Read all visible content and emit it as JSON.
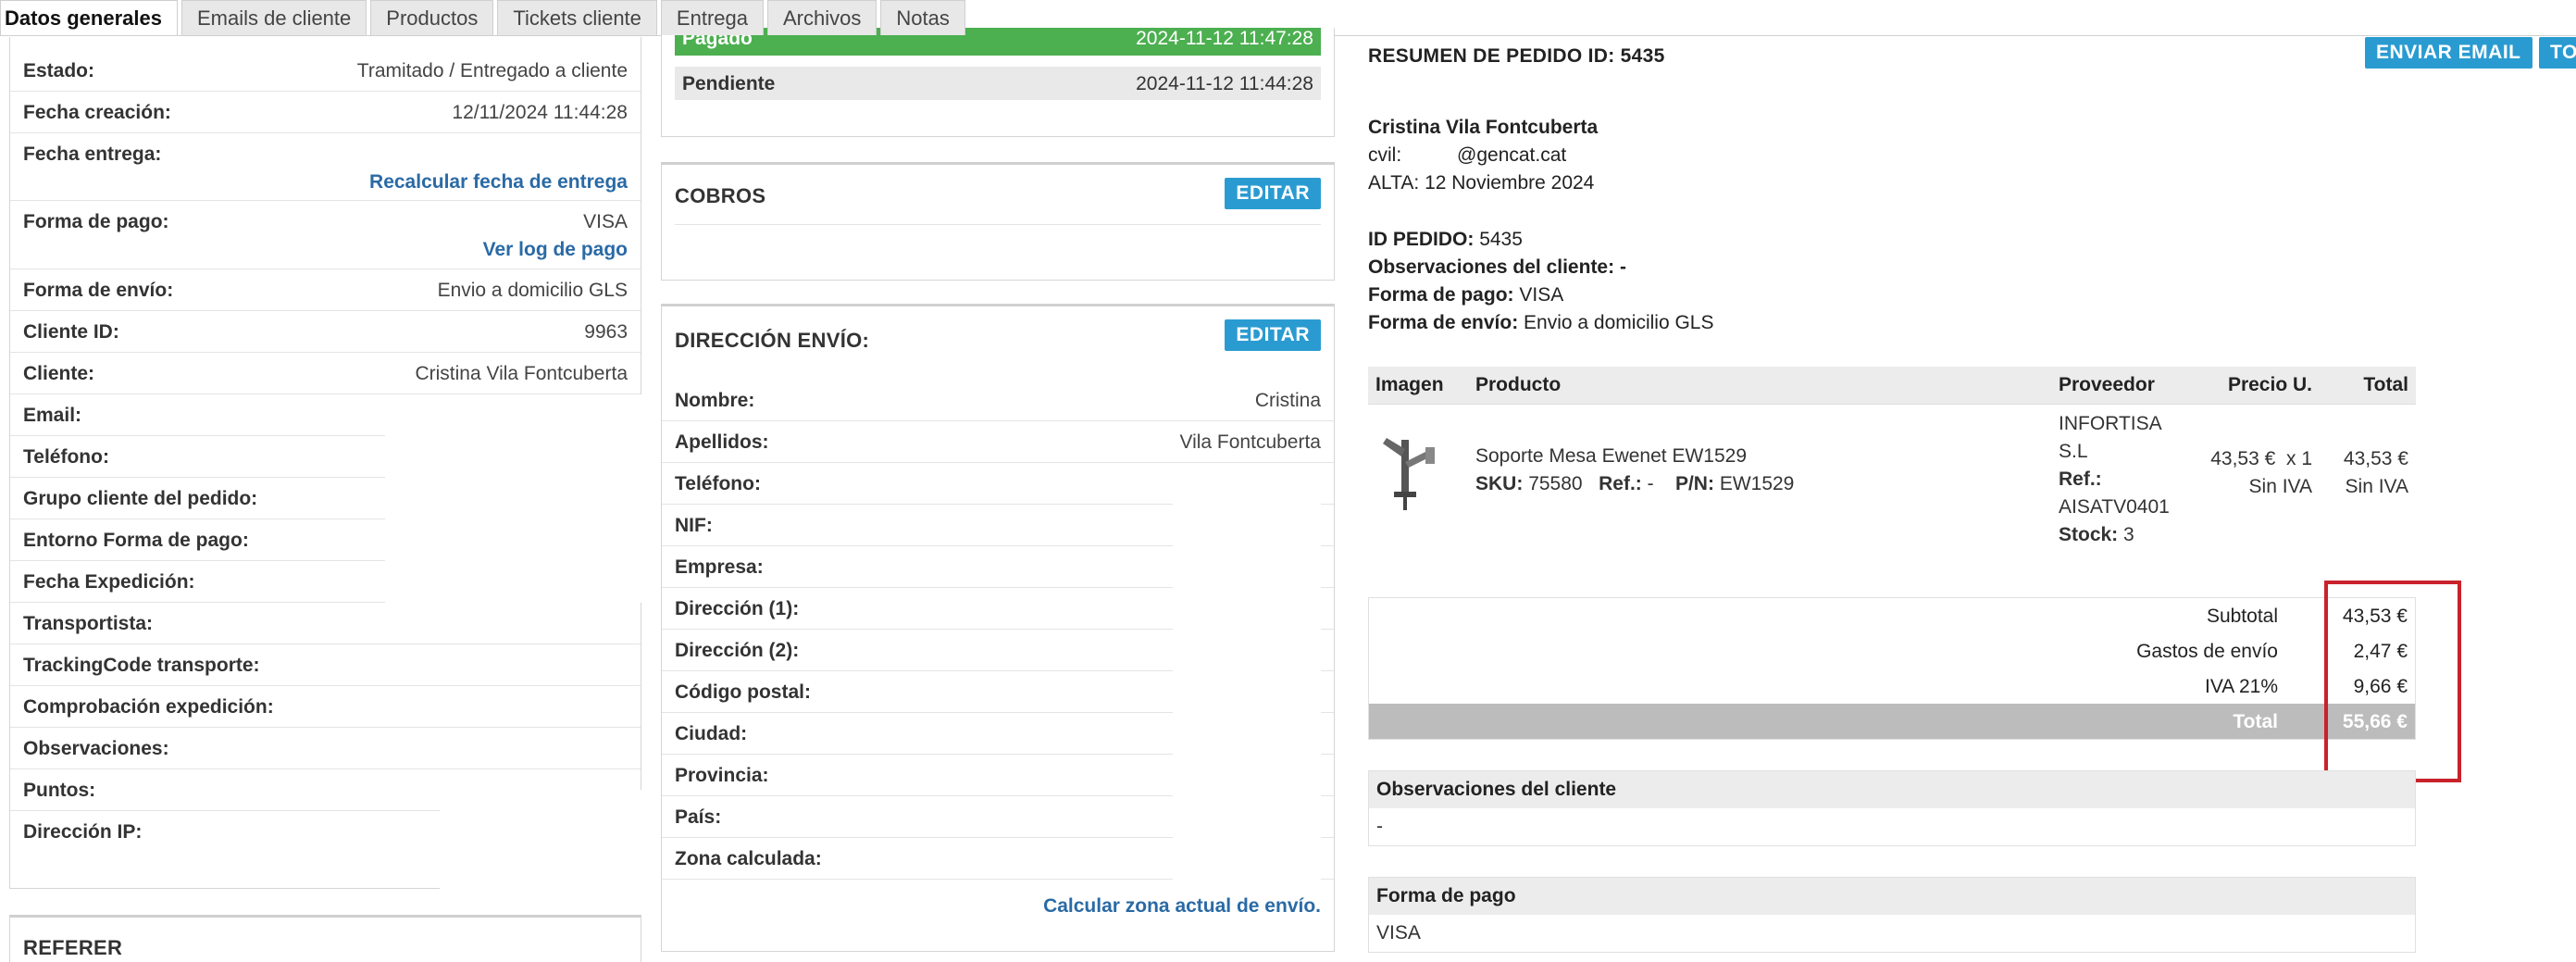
{
  "tabs": [
    "Datos generales",
    "Emails de cliente",
    "Productos",
    "Tickets cliente",
    "Entrega",
    "Archivos",
    "Notas"
  ],
  "general": {
    "rows": [
      {
        "label": "Estado:",
        "value": "Tramitado / Entregado a cliente"
      },
      {
        "label": "Fecha creación:",
        "value": "12/11/2024 11:44:28"
      },
      {
        "label": "Fecha entrega:",
        "value": ""
      },
      {
        "label": "Forma de pago:",
        "value": "VISA"
      },
      {
        "label": "Forma de envío:",
        "value": "Envio a domicilio GLS"
      },
      {
        "label": "Cliente ID:",
        "value": "9963"
      },
      {
        "label": "Cliente:",
        "value": "Cristina Vila Fontcuberta"
      },
      {
        "label": "Email:",
        "value": ""
      },
      {
        "label": "Teléfono:",
        "value": ""
      },
      {
        "label": "Grupo cliente del pedido:",
        "value": ""
      },
      {
        "label": "Entorno Forma de pago:",
        "value": ""
      },
      {
        "label": "Fecha Expedición:",
        "value": ""
      },
      {
        "label": "Transportista:",
        "value": ""
      },
      {
        "label": "TrackingCode transporte:",
        "value": ""
      },
      {
        "label": "Comprobación expedición:",
        "value": ""
      },
      {
        "label": "Observaciones:",
        "value": ""
      },
      {
        "label": "Puntos:",
        "value": ""
      },
      {
        "label": "Dirección IP:",
        "value": ""
      }
    ],
    "recalc_link": "Recalcular fecha de entrega",
    "log_link": "Ver log de pago",
    "referer_title": "REFERER"
  },
  "payments_status": [
    {
      "label": "Pagado",
      "date": "2024-11-12 11:47:28"
    },
    {
      "label": "Pendiente",
      "date": "2024-11-12 11:44:28"
    }
  ],
  "cobros": {
    "title": "COBROS",
    "edit": "EDITAR"
  },
  "direccion": {
    "title": "DIRECCIÓN ENVÍO:",
    "edit": "EDITAR",
    "rows": [
      {
        "label": "Nombre:",
        "value": "Cristina"
      },
      {
        "label": "Apellidos:",
        "value": "Vila Fontcuberta"
      },
      {
        "label": "Teléfono:",
        "value": ""
      },
      {
        "label": "NIF:",
        "value": ""
      },
      {
        "label": "Empresa:",
        "value": ""
      },
      {
        "label": "Dirección (1):",
        "value": ""
      },
      {
        "label": "Dirección (2):",
        "value": ""
      },
      {
        "label": "Código postal:",
        "value": ""
      },
      {
        "label": "Ciudad:",
        "value": ""
      },
      {
        "label": "Provincia:",
        "value": ""
      },
      {
        "label": "País:",
        "value": ""
      },
      {
        "label": "Zona calculada:",
        "value": ""
      }
    ],
    "calc_link": "Calcular zona actual de envío."
  },
  "summary": {
    "title": "RESUMEN DE PEDIDO ID: 5435",
    "email_btn": "ENVIAR EMAIL",
    "to_btn": "TO",
    "customer_name": "Cristina  Vila Fontcuberta",
    "email_user": "cvil:",
    "email_domain": "@gencat.cat",
    "alta": "ALTA: 12 Noviembre 2024",
    "id_label": "ID PEDIDO:",
    "id_value": "5435",
    "obs_label": "Observaciones del cliente:",
    "obs_value": "-",
    "pago_label": "Forma de pago:",
    "pago_value": "VISA",
    "envio_label": "Forma de envío:",
    "envio_value": "Envio a domicilio GLS"
  },
  "product_table": {
    "headers": [
      "Imagen",
      "Producto",
      "Proveedor",
      "Precio U.",
      "Total"
    ],
    "item": {
      "name": "Soporte Mesa Ewenet EW1529",
      "sku_label": "SKU:",
      "sku": "75580",
      "ref_label": "Ref.:",
      "ref": "-",
      "pn_label": "P/N:",
      "pn": "EW1529",
      "supplier": "INFORTISA S.L",
      "supplier_ref_label": "Ref.:",
      "supplier_ref": "AISATV0401",
      "stock_label": "Stock:",
      "stock": "3",
      "unit_price": "43,53 €",
      "qty": "x 1",
      "unit_note": "Sin IVA",
      "total": "43,53 €",
      "total_note": "Sin IVA"
    }
  },
  "totals": [
    {
      "label": "Subtotal",
      "value": "43,53 €"
    },
    {
      "label": "Gastos de envío",
      "value": "2,47 €"
    },
    {
      "label": "IVA 21%",
      "value": "9,66 €"
    },
    {
      "label": "Total",
      "value": "55,66 €"
    }
  ],
  "obs_box": {
    "title": "Observaciones del cliente",
    "value": "-"
  },
  "pago_box": {
    "title": "Forma de pago",
    "value": "VISA"
  },
  "colors": {
    "accent": "#2a9bd1",
    "paid": "#4caf50",
    "highlight": "#c9222b"
  }
}
